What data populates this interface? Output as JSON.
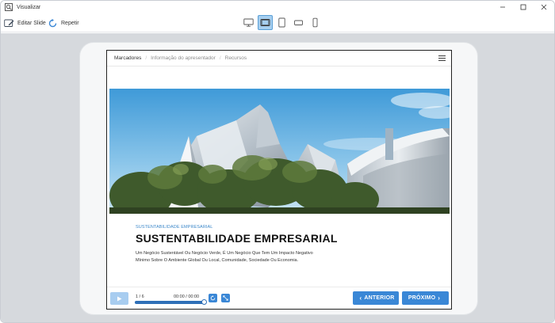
{
  "window": {
    "title": "Visualizar",
    "app_icon": "preview-icon",
    "controls": [
      "minimize-icon",
      "maximize-icon",
      "close-icon"
    ]
  },
  "toolbar": {
    "edit_label": "Editar Slide",
    "repeat_label": "Repetir",
    "devices": [
      {
        "name": "desktop",
        "icon": "desktop-icon",
        "active": false
      },
      {
        "name": "tablet-landscape",
        "icon": "tablet-landscape-icon",
        "active": true
      },
      {
        "name": "tablet-portrait",
        "icon": "tablet-portrait-icon",
        "active": false
      },
      {
        "name": "phone-landscape",
        "icon": "phone-landscape-icon",
        "active": false
      },
      {
        "name": "phone-portrait",
        "icon": "phone-portrait-icon",
        "active": false
      }
    ]
  },
  "slide": {
    "nav": {
      "items": [
        "Marcadores",
        "Informação do apresentador",
        "Recursos"
      ],
      "menu_icon": "hamburger-icon"
    },
    "image": "architecture-building-photo",
    "kicker": "SUSTENTABILIDADE EMPRESARIAL",
    "headline": "SUSTENTABILIDADE EMPRESARIAL",
    "body_line1": "Um Negócio Sustentável Ou Negócio Verde, É Um Negócio Que Tem Um Impacto Negativo",
    "body_line2": "Mínimo Sobre O Ambiente Global Ou Local, Comunidade, Sociedade Ou Economia."
  },
  "player": {
    "counter": "1 / 6",
    "time": "00:00 / 00:00",
    "progress_fraction": 1.0,
    "prev_label": "ANTERIOR",
    "next_label": "PRÓXIMO",
    "colors": {
      "accent": "#3a87d6",
      "play_disabled": "#a8cdf0"
    }
  }
}
